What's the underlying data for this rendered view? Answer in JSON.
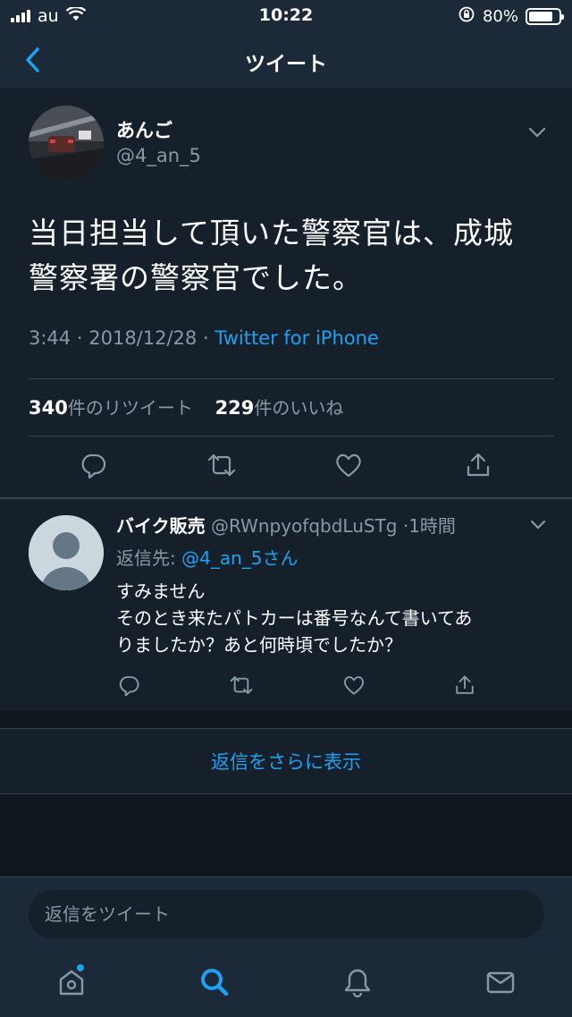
{
  "status_bar": {
    "carrier": "au",
    "time": "10:22",
    "battery": "80%",
    "battery_level": 0.8,
    "icons": [
      "signal-icon",
      "wifi-icon",
      "orientation-lock-icon",
      "battery-icon"
    ]
  },
  "nav": {
    "title": "ツイート",
    "back_icon": "chevron-left-icon"
  },
  "tweet": {
    "author_name": "あんご",
    "author_handle": "@4_an_5",
    "text_line1": "当日担当して頂いた警察官は、成城",
    "text_line2": "警察署の警察官でした。",
    "time": "3:44",
    "date": "2018/12/28",
    "dot": "·",
    "source": "Twitter for iPhone",
    "retweet_count": "340",
    "retweet_label": "件のリツイート",
    "like_count": "229",
    "like_label": "件のいいね",
    "action_icons": [
      "reply-icon",
      "retweet-icon",
      "like-icon",
      "share-icon"
    ]
  },
  "reply": {
    "name": "バイク販売",
    "handle": "@RWnpyofqbdLuSTg",
    "time_sep": "·",
    "time": "1時間",
    "reply_to_prefix": "返信先: ",
    "reply_to_mention": "@4_an_5さん",
    "text_lines": [
      "すみません",
      "そのとき来たパトカーは番号なんて書いてあ",
      "りましたか？あと何時頃でしたか？"
    ]
  },
  "show_more": "返信をさらに表示",
  "compose": {
    "placeholder": "返信をツイート"
  },
  "tabs": [
    {
      "icon": "home-icon"
    },
    {
      "icon": "search-icon",
      "active": true
    },
    {
      "icon": "notifications-icon"
    },
    {
      "icon": "messages-icon"
    }
  ],
  "colors": {
    "background": "#15202b",
    "bar": "#1c2938",
    "accent": "#1da1f2",
    "secondary_text": "#8899a6"
  }
}
